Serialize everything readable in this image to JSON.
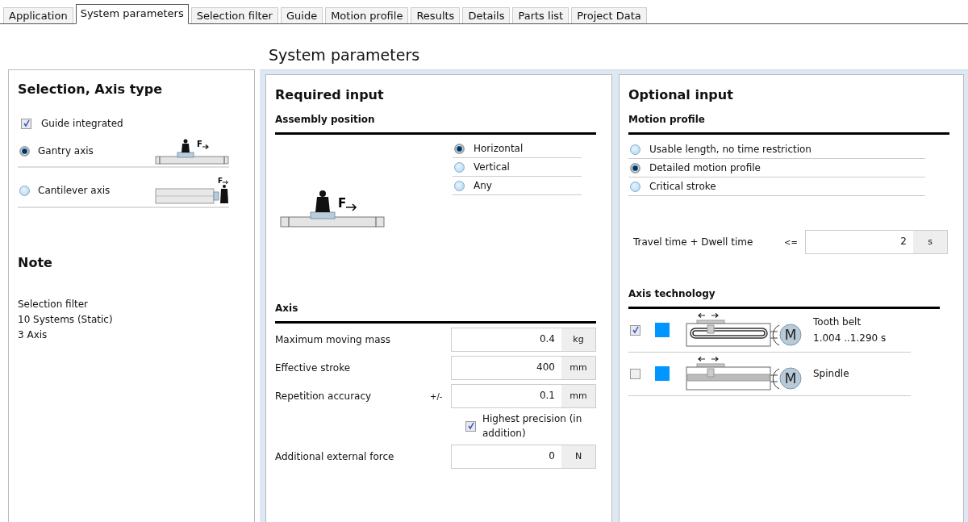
{
  "tabs": [
    {
      "label": "Application",
      "selected": false
    },
    {
      "label": "System parameters",
      "selected": true
    },
    {
      "label": "Selection filter",
      "selected": false
    },
    {
      "label": "Guide",
      "selected": false
    },
    {
      "label": "Motion profile",
      "selected": false
    },
    {
      "label": "Results",
      "selected": false
    },
    {
      "label": "Details",
      "selected": false
    },
    {
      "label": "Parts list",
      "selected": false
    },
    {
      "label": "Project Data",
      "selected": false
    }
  ],
  "page_title": "System parameters",
  "axis_type_panel": {
    "title": "Selection, Axis type",
    "guide_integrated": {
      "label": "Guide integrated",
      "checked": true
    },
    "axis_types": [
      {
        "label": "Gantry axis",
        "selected": true,
        "kind": "gantry",
        "force_label": "F"
      },
      {
        "label": "Cantilever axis",
        "selected": false,
        "kind": "cantilever",
        "force_label": "F"
      }
    ],
    "note_title": "Note",
    "note_lines": [
      "Selection filter",
      "10 Systems (Static)",
      "3 Axis"
    ]
  },
  "required_input": {
    "title": "Required input",
    "assembly_position": {
      "heading": "Assembly position",
      "force_label": "F",
      "options": [
        {
          "label": "Horizontal",
          "selected": true
        },
        {
          "label": "Vertical",
          "selected": false
        },
        {
          "label": "Any",
          "selected": false
        }
      ]
    },
    "axis": {
      "heading": "Axis",
      "fields": [
        {
          "label": "Maximum moving mass",
          "value": "0.4",
          "unit": "kg"
        },
        {
          "label": "Effective stroke",
          "value": "400",
          "unit": "mm"
        },
        {
          "label": "Repetition accuracy",
          "prefix": "+/-",
          "value": "0.1",
          "unit": "mm"
        },
        {
          "label": "Additional external force",
          "value": "0",
          "unit": "N"
        }
      ],
      "highest_precision": {
        "label": "Highest precision (in addition)",
        "checked": true
      }
    }
  },
  "optional_input": {
    "title": "Optional input",
    "motion_profile": {
      "heading": "Motion profile",
      "options": [
        {
          "label": "Usable length, no time restriction",
          "selected": false
        },
        {
          "label": "Detailed motion profile",
          "selected": true
        },
        {
          "label": "Critical stroke",
          "selected": false
        }
      ],
      "time_field": {
        "label": "Travel time + Dwell time",
        "prefix": "<=",
        "value": "2",
        "unit": "s"
      }
    },
    "axis_technology": {
      "heading": "Axis technology",
      "items": [
        {
          "label": "Tooth belt",
          "result": "1.004 ..1.290 s",
          "checked": true,
          "color": "#0096ff",
          "kind": "belt",
          "motor_label": "M"
        },
        {
          "label": "Spindle",
          "checked": false,
          "color": "#0096ff",
          "kind": "spindle",
          "motor_label": "M"
        }
      ]
    }
  }
}
